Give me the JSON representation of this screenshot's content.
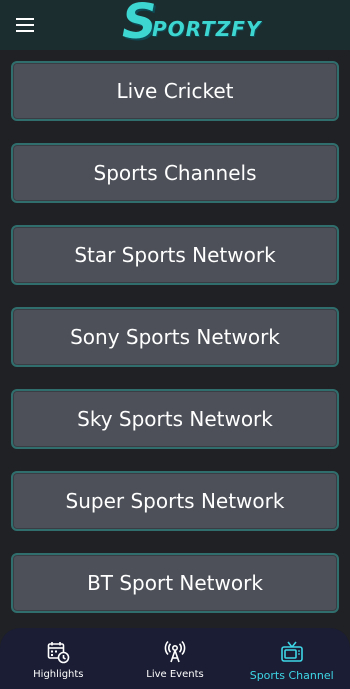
{
  "header": {
    "logo_first": "S",
    "logo_rest": "PORTZFY",
    "menu_icon": "hamburger-menu-icon"
  },
  "categories": [
    {
      "label": "Live Cricket"
    },
    {
      "label": "Sports Channels"
    },
    {
      "label": "Star Sports Network"
    },
    {
      "label": "Sony Sports Network"
    },
    {
      "label": "Sky Sports Network"
    },
    {
      "label": "Super Sports Network"
    },
    {
      "label": "BT Sport Network"
    }
  ],
  "bottom_nav": {
    "items": [
      {
        "label": "Highlights",
        "icon": "calendar-clock-icon"
      },
      {
        "label": "Live Events",
        "icon": "broadcast-tower-icon"
      },
      {
        "label": "Sports Channel",
        "icon": "tv-icon"
      }
    ],
    "active_index": 2
  },
  "colors": {
    "background": "#1f2124",
    "appbar": "#1c2d30",
    "button_fill": "#4d5058",
    "button_border": "#2f6e6c",
    "accent": "#3ed6e6",
    "nav_bg": "#1a1d33"
  }
}
